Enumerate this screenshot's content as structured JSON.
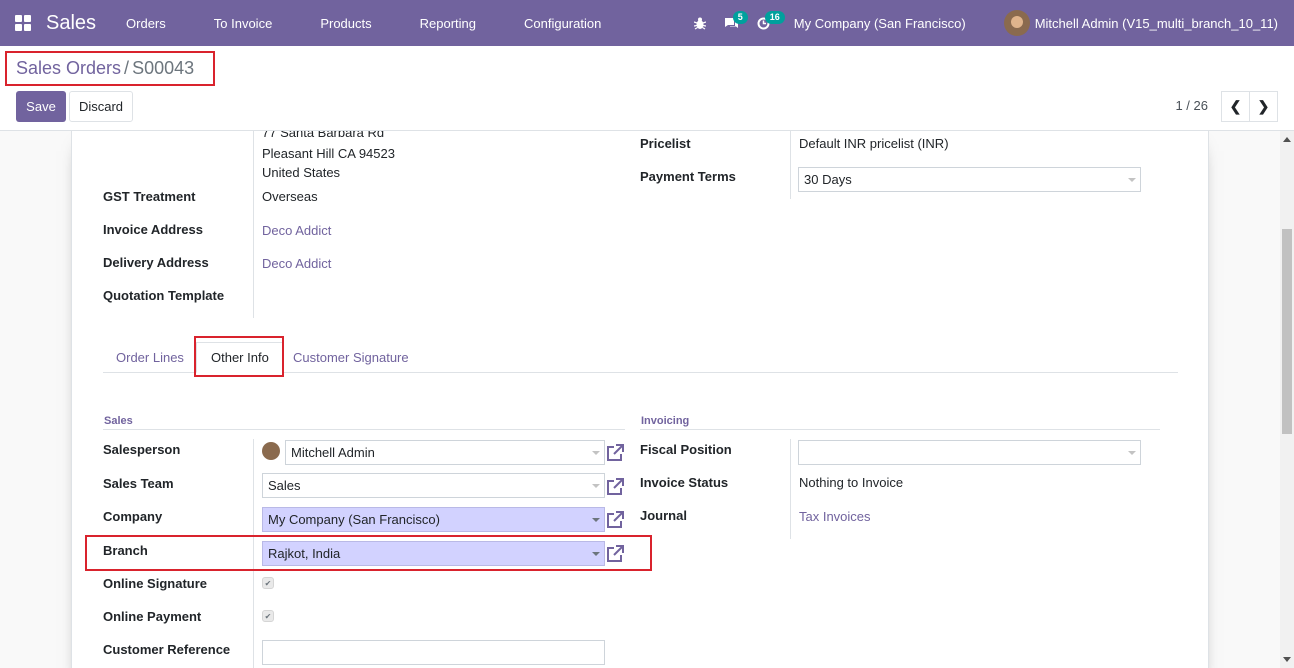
{
  "navbar": {
    "app_name": "Sales",
    "menu": [
      "Orders",
      "To Invoice",
      "Products",
      "Reporting",
      "Configuration"
    ],
    "messages_count": "5",
    "activities_count": "16",
    "company": "My Company (San Francisco)",
    "user": "Mitchell Admin (V15_multi_branch_10_11)",
    "icons": {
      "apps": "apps-grid-icon",
      "debug": "bug-icon",
      "messages": "chat-bubbles-icon",
      "activities": "clock-icon"
    }
  },
  "control_panel": {
    "breadcrumb_parent": "Sales Orders",
    "breadcrumb_sep": "/",
    "breadcrumb_current": "S00043",
    "save_label": "Save",
    "discard_label": "Discard",
    "pager": "1 / 26",
    "prev": "❮",
    "next": "❯"
  },
  "customer_address": {
    "line1": "77 Santa Barbara Rd",
    "line2": "Pleasant Hill CA 94523",
    "line3": "United States"
  },
  "header_fields": {
    "gst_treatment_label": "GST Treatment",
    "gst_treatment_value": "Overseas",
    "invoice_address_label": "Invoice Address",
    "invoice_address_value": "Deco Addict",
    "delivery_address_label": "Delivery Address",
    "delivery_address_value": "Deco Addict",
    "quotation_template_label": "Quotation Template",
    "pricelist_label": "Pricelist",
    "pricelist_value": "Default INR pricelist (INR)",
    "payment_terms_label": "Payment Terms",
    "payment_terms_value": "30 Days"
  },
  "tabs": [
    "Order Lines",
    "Other Info",
    "Customer Signature"
  ],
  "active_tab": "Other Info",
  "sales_group": {
    "title": "Sales",
    "salesperson_label": "Salesperson",
    "salesperson_value": "Mitchell Admin",
    "sales_team_label": "Sales Team",
    "sales_team_value": "Sales",
    "company_label": "Company",
    "company_value": "My Company (San Francisco)",
    "branch_label": "Branch",
    "branch_value": "Rajkot, India",
    "online_signature_label": "Online Signature",
    "online_signature_checked": true,
    "online_payment_label": "Online Payment",
    "online_payment_checked": true,
    "customer_reference_label": "Customer Reference",
    "customer_reference_value": ""
  },
  "invoicing_group": {
    "title": "Invoicing",
    "fiscal_position_label": "Fiscal Position",
    "fiscal_position_value": "",
    "invoice_status_label": "Invoice Status",
    "invoice_status_value": "Nothing to Invoice",
    "journal_label": "Journal",
    "journal_value": "Tax Invoices"
  },
  "colors": {
    "brand": "#71639e",
    "badge": "#00a09d",
    "required_field": "#d2d2ff",
    "highlight": "#d9232d"
  }
}
